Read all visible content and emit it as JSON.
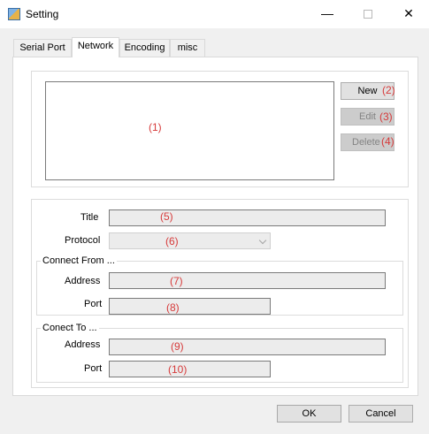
{
  "window": {
    "title": "Setting",
    "minimize_glyph": "—",
    "close_glyph": "✕",
    "icon": "app-settings-icon"
  },
  "tabs": [
    {
      "label": "Serial Port",
      "active": false
    },
    {
      "label": "Network",
      "active": true
    },
    {
      "label": "Encoding",
      "active": false
    },
    {
      "label": "misc",
      "active": false
    }
  ],
  "network": {
    "list_annotation": "(1)",
    "buttons": {
      "new": {
        "label": "New",
        "annotation": "(2)",
        "enabled": true
      },
      "edit": {
        "label": "Edit",
        "annotation": "(3)",
        "enabled": false
      },
      "delete": {
        "label": "Delete",
        "annotation": "(4)",
        "enabled": false
      }
    },
    "title": {
      "label": "Title",
      "value": "",
      "annotation": "(5)"
    },
    "protocol": {
      "label": "Protocol",
      "value": "",
      "annotation": "(6)"
    },
    "connect_from": {
      "group_label": "Connect From ...",
      "address": {
        "label": "Address",
        "value": "",
        "annotation": "(7)"
      },
      "port": {
        "label": "Port",
        "value": "",
        "annotation": "(8)"
      }
    },
    "connect_to": {
      "group_label": "Conect To ...",
      "address": {
        "label": "Address",
        "value": "",
        "annotation": "(9)"
      },
      "port": {
        "label": "Port",
        "value": "",
        "annotation": "(10)"
      }
    }
  },
  "footer": {
    "ok_label": "OK",
    "cancel_label": "Cancel"
  },
  "colors": {
    "annotation": "#d63a3a",
    "window_bg": "#f0f0f0",
    "panel_bg": "#ffffff"
  }
}
